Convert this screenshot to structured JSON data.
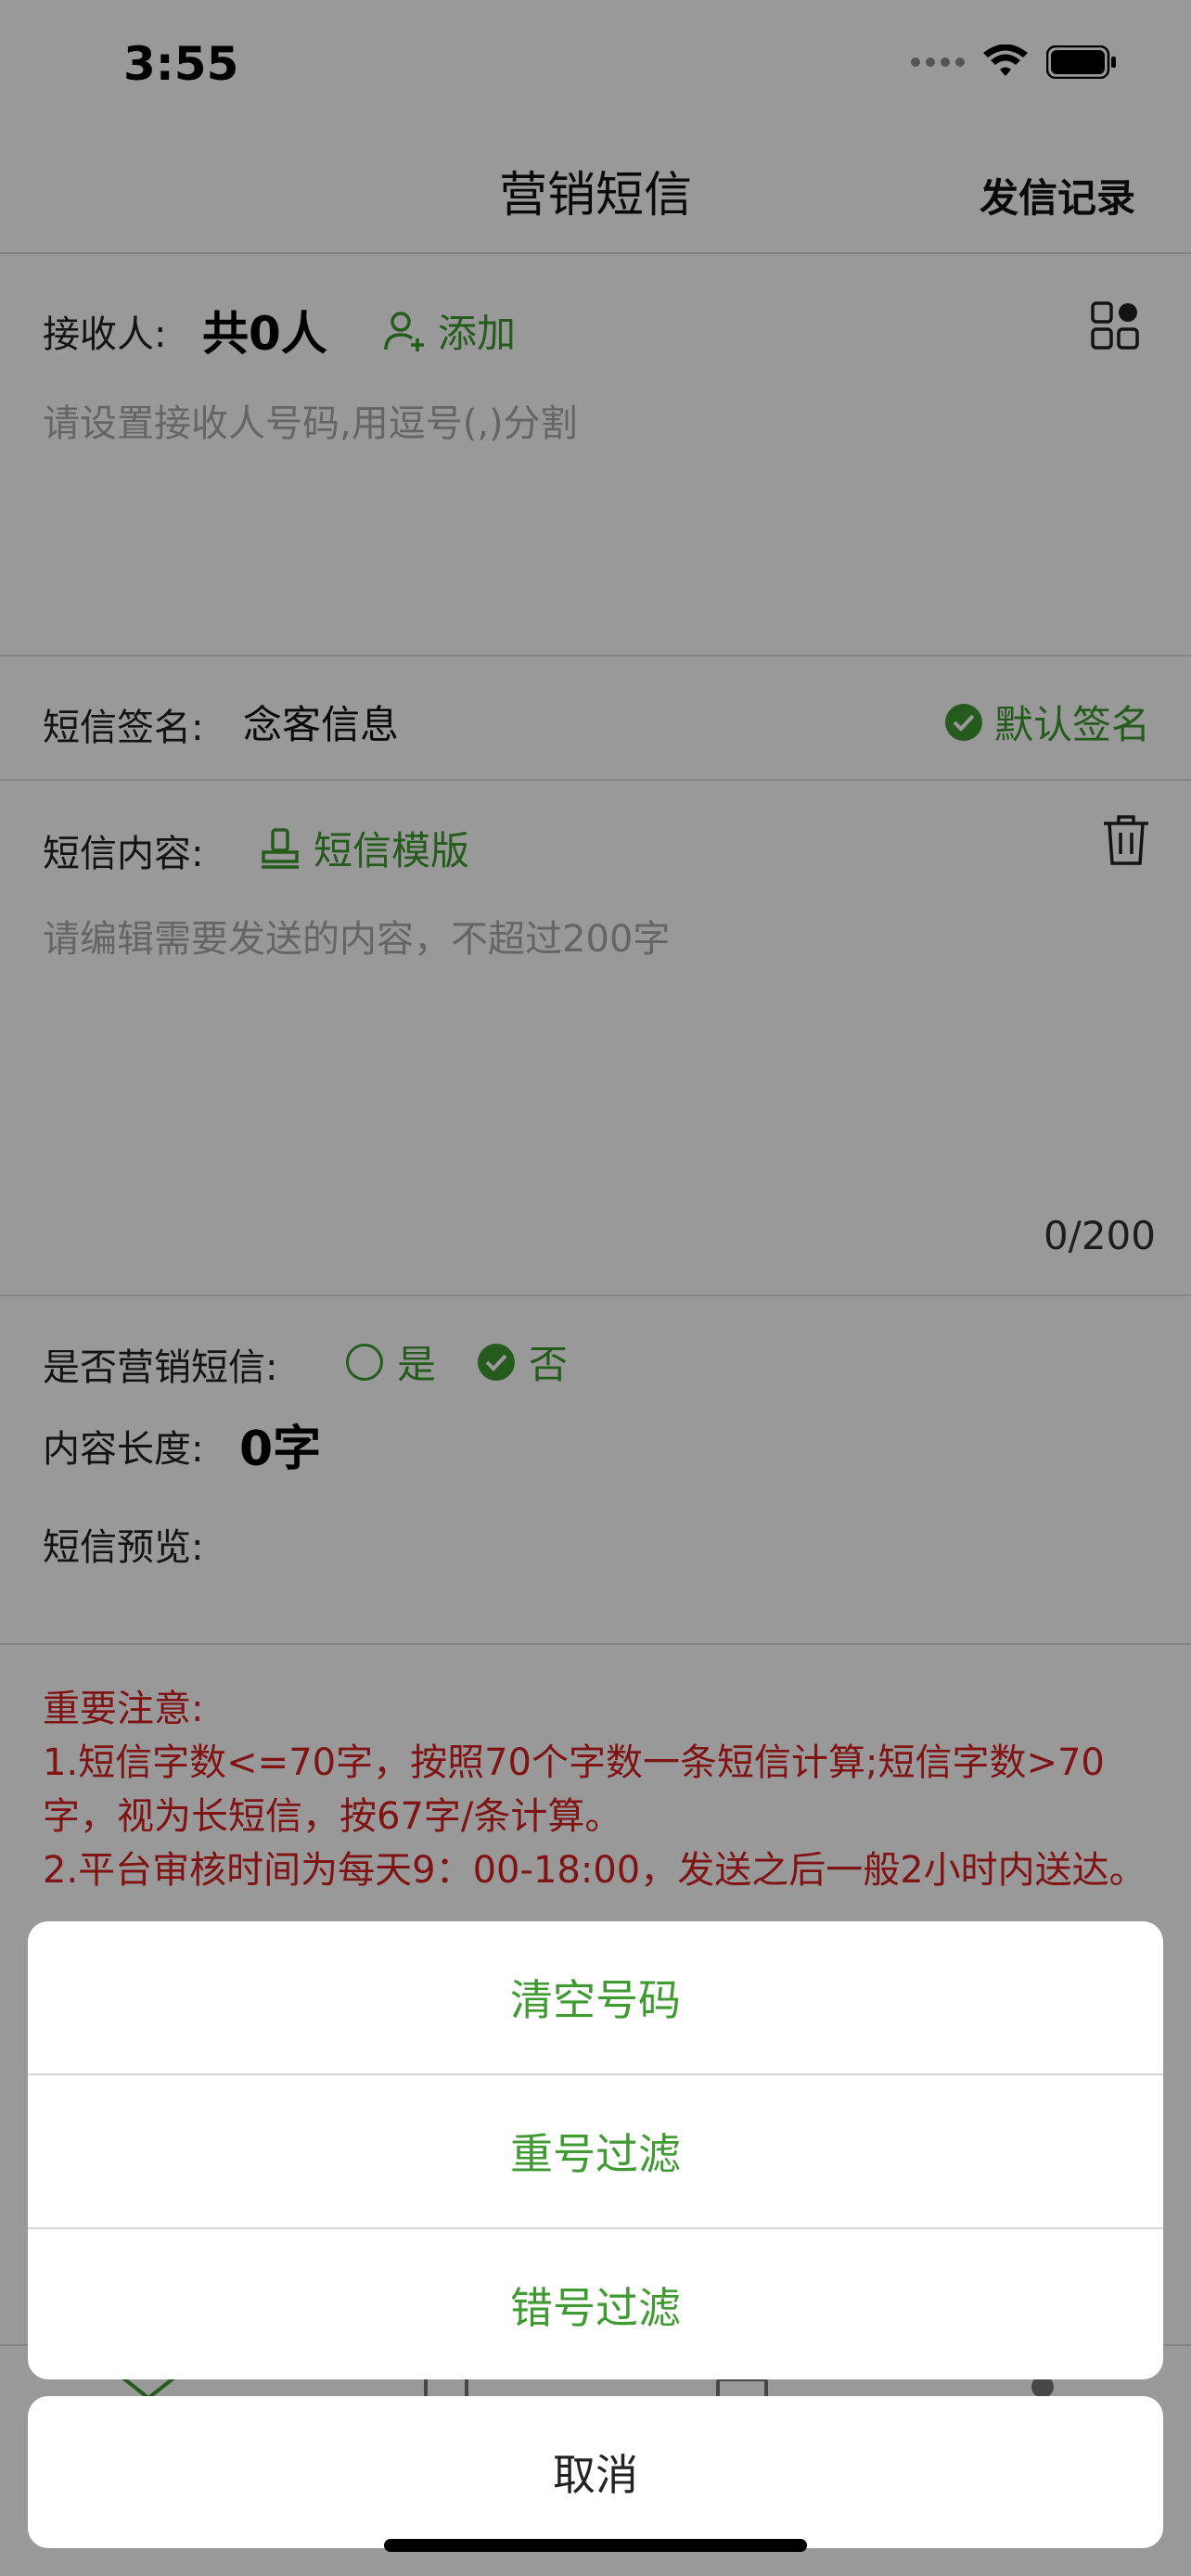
{
  "status_bar": {
    "time": "3:55"
  },
  "nav": {
    "title": "营销短信",
    "right_action": "发信记录"
  },
  "recipients": {
    "label": "接收人:",
    "count": "共0人",
    "add_label": "添加",
    "placeholder": "请设置接收人号码,用逗号(,)分割"
  },
  "signature": {
    "label": "短信签名:",
    "value": "念客信息",
    "default_label": "默认签名"
  },
  "content": {
    "label": "短信内容:",
    "template_label": "短信模版",
    "placeholder": "请编辑需要发送的内容，不超过200字",
    "counter": "0/200"
  },
  "options": {
    "marketing_label": "是否营销短信:",
    "yes_label": "是",
    "no_label": "否",
    "selected": "否",
    "length_label": "内容长度:",
    "length_value": "0字",
    "preview_label": "短信预览:"
  },
  "notice": {
    "title": "重要注意:",
    "line1": "1.短信字数<=70字，按照70个字数一条短信计算;短信字数>70字，视为长短信，按67字/条计算。",
    "line2": "2.平台审核时间为每天9：00-18:00，发送之后一般2小时内送达。"
  },
  "action_sheet": {
    "items": [
      "清空号码",
      "重号过滤",
      "错号过滤"
    ],
    "cancel": "取消"
  },
  "colors": {
    "accent": "#3f9a31",
    "notice": "#d62121",
    "overlay": "rgba(0,0,0,0.40)"
  }
}
